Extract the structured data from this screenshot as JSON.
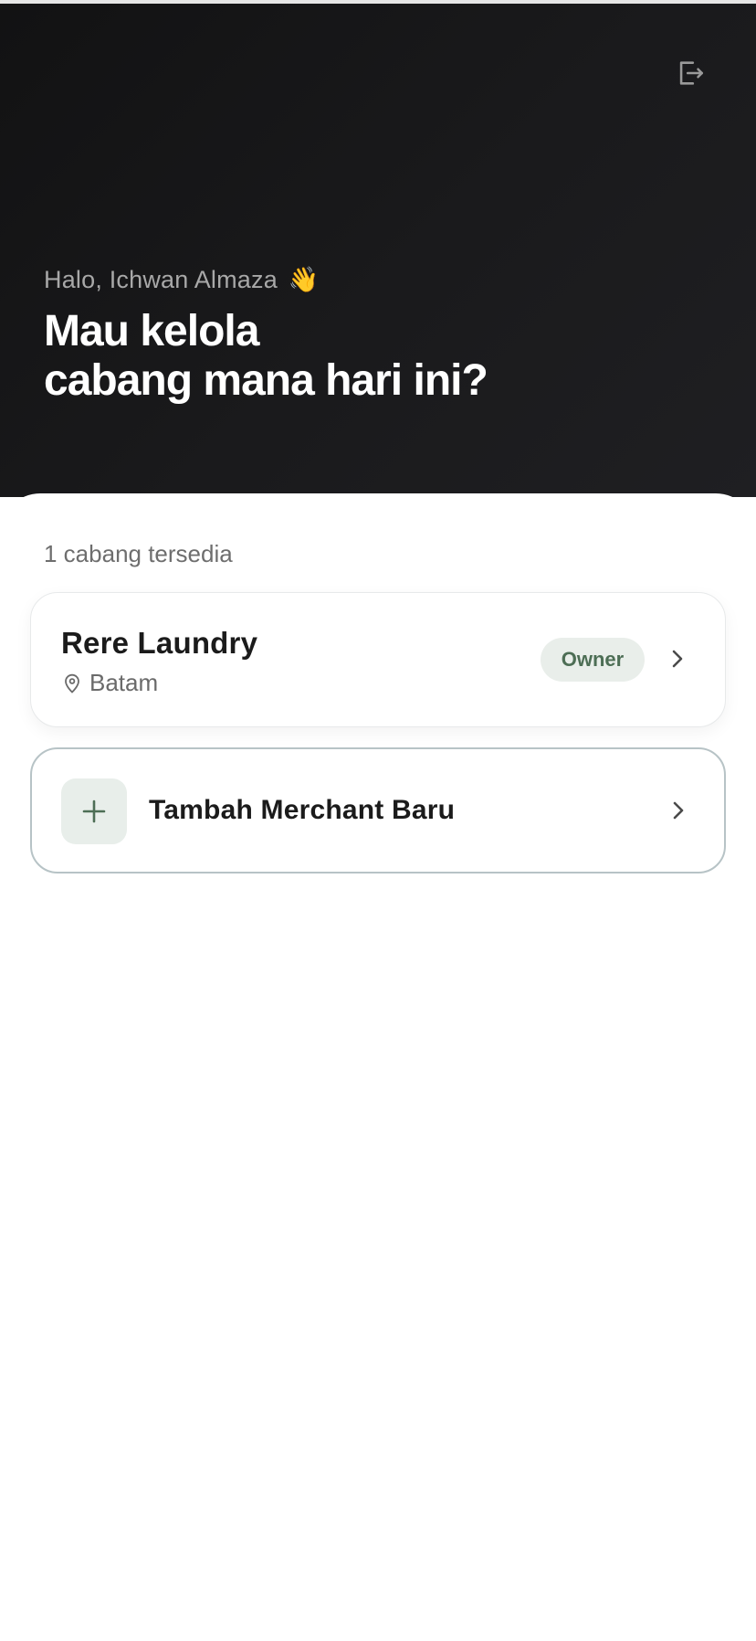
{
  "header": {
    "greeting": "Halo, Ichwan Almaza",
    "greeting_emoji": "👋",
    "headline_line1": "Mau kelola",
    "headline_line2": "cabang mana hari ini?",
    "logout_icon": "logout-icon"
  },
  "branches": {
    "count_label": "1 cabang tersedia",
    "items": [
      {
        "name": "Rere Laundry",
        "location": "Batam",
        "role": "Owner"
      }
    ]
  },
  "add_merchant": {
    "label": "Tambah Merchant Baru"
  },
  "colors": {
    "hero_bg": "#161618",
    "accent_green": "#4d6e55",
    "badge_bg": "#e9eeea"
  }
}
